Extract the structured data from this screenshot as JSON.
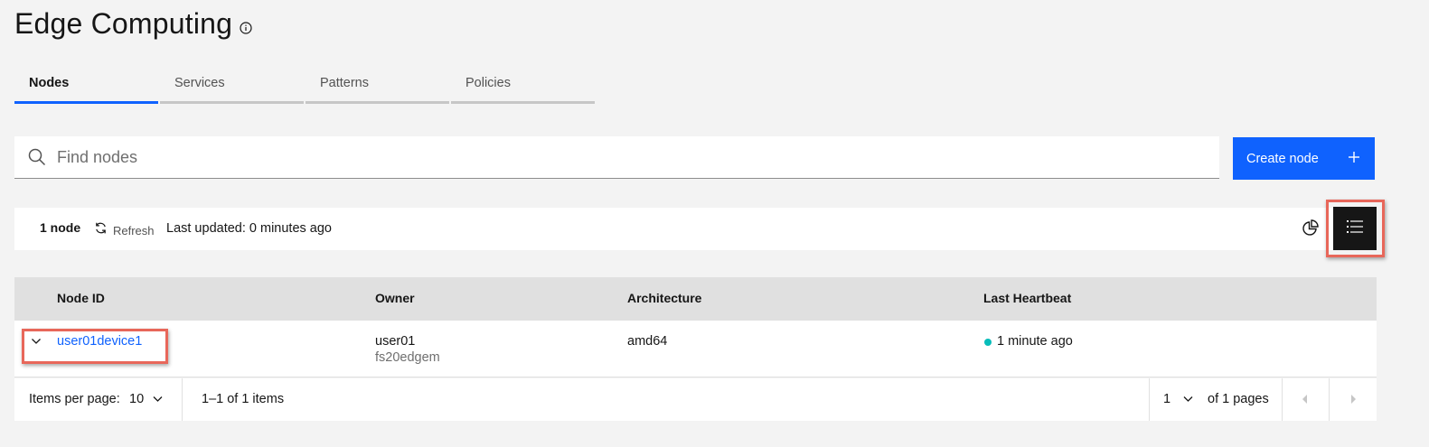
{
  "page": {
    "title": "Edge Computing"
  },
  "tabs": [
    {
      "label": "Nodes",
      "active": true
    },
    {
      "label": "Services",
      "active": false
    },
    {
      "label": "Patterns",
      "active": false
    },
    {
      "label": "Policies",
      "active": false
    }
  ],
  "search": {
    "placeholder": "Find nodes",
    "value": ""
  },
  "create_button": {
    "label": "Create node",
    "icon": "plus-icon"
  },
  "toolbar": {
    "count": "1 node",
    "refresh_label": "Refresh",
    "last_updated": "Last updated: 0 minutes ago",
    "view_chart_icon": "pie-chart-icon",
    "view_list_icon": "list-icon"
  },
  "table": {
    "columns": [
      "Node ID",
      "Owner",
      "Architecture",
      "Last Heartbeat"
    ],
    "rows": [
      {
        "node_id": "user01device1",
        "owner": "user01",
        "owner_org": "fs20edgem",
        "architecture": "amd64",
        "last_heartbeat": "1 minute ago"
      }
    ]
  },
  "pagination": {
    "items_per_page_label": "Items per page:",
    "items_per_page": "10",
    "range": "1–1 of 1 items",
    "page": "1",
    "of_pages": "of 1 pages"
  },
  "colors": {
    "accent": "#0f62fe",
    "highlight": "#e8675a",
    "status_ok": "#08bdba"
  }
}
